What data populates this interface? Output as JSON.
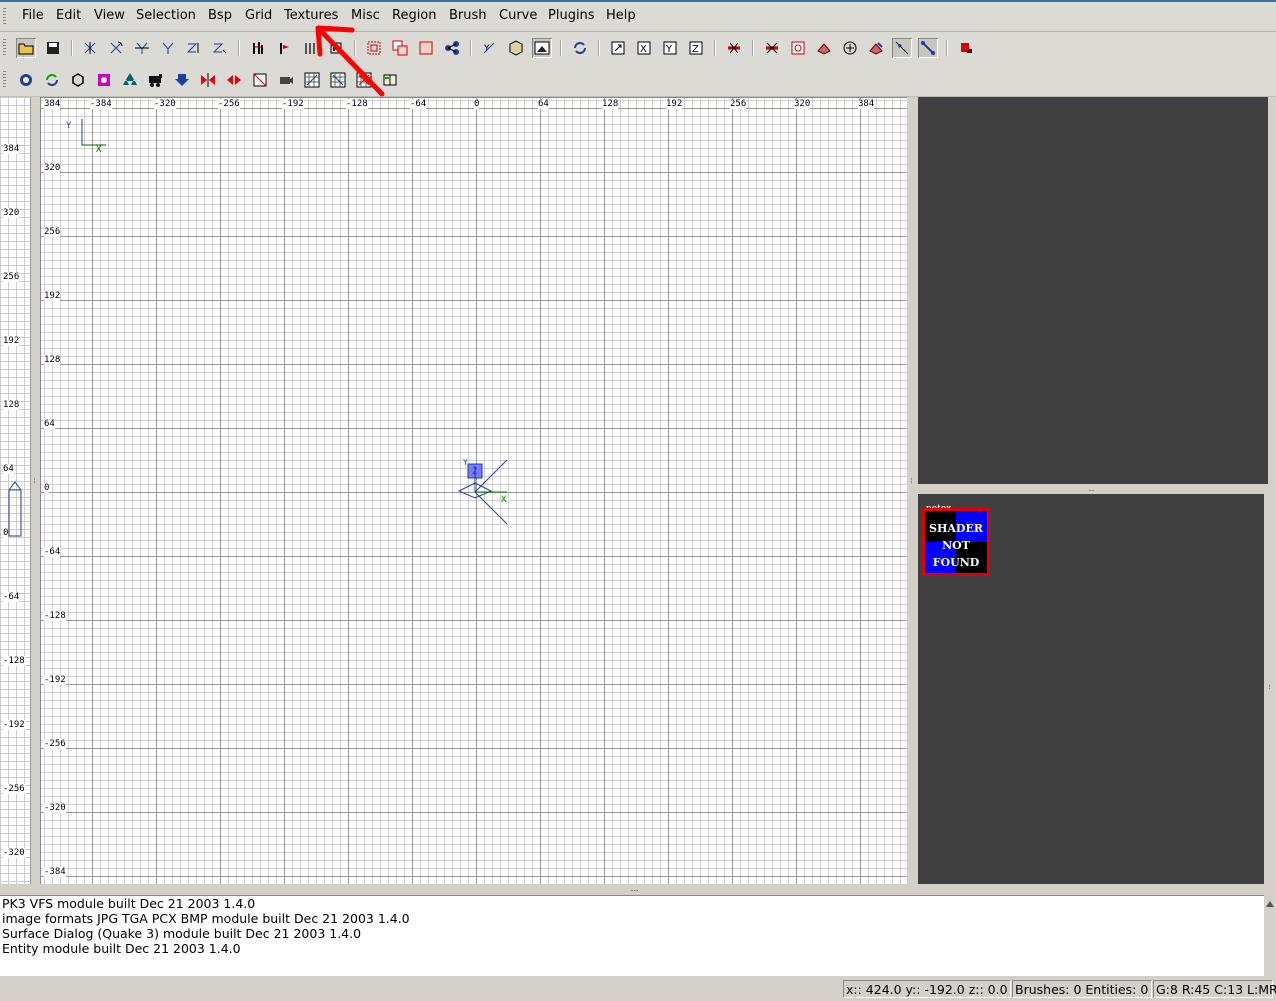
{
  "menubar": {
    "items": [
      "File",
      "Edit",
      "View",
      "Selection",
      "Bsp",
      "Grid",
      "Textures",
      "Misc",
      "Region",
      "Brush",
      "Curve",
      "Plugins",
      "Help"
    ]
  },
  "grid_view": {
    "top_labels": [
      "-384",
      "-320",
      "-256",
      "-192",
      "-128",
      "-64",
      "0",
      "64",
      "128",
      "192",
      "256",
      "320",
      "384"
    ],
    "top_left_label": "384",
    "left_labels": [
      "320",
      "256",
      "192",
      "128",
      "64",
      "0",
      "-64",
      "-128",
      "-192",
      "-256",
      "-320",
      "-384"
    ],
    "axis_y": "Y",
    "axis_x": "X",
    "origin_y": "Y",
    "origin_z": "Z",
    "origin_x": "X"
  },
  "z_ruler": {
    "labels": [
      "384",
      "320",
      "256",
      "192",
      "128",
      "64",
      "0",
      "-64",
      "-128",
      "-192",
      "-256",
      "-320"
    ]
  },
  "texture_browser": {
    "texture_name": "notex",
    "thumb_lines": [
      "SHADER",
      "NOT",
      "FOUND"
    ],
    "border_color": "#e00000"
  },
  "console": {
    "lines": [
      "PK3 VFS module built Dec 21 2003 1.4.0",
      "image formats JPG TGA PCX BMP module built Dec 21 2003 1.4.0",
      "Surface Dialog (Quake 3) module built Dec 21 2003 1.4.0",
      "Entity module built Dec 21 2003 1.4.0"
    ]
  },
  "statusbar": {
    "coords": "x:: 424.0  y:: -192.0  z:: 0.0",
    "counts": "Brushes: 0 Entities: 0",
    "grid": "G:8 R:45 C:13 L:MR"
  },
  "annotation": {
    "arrow_color": "#ff0000",
    "target": "Textures"
  }
}
